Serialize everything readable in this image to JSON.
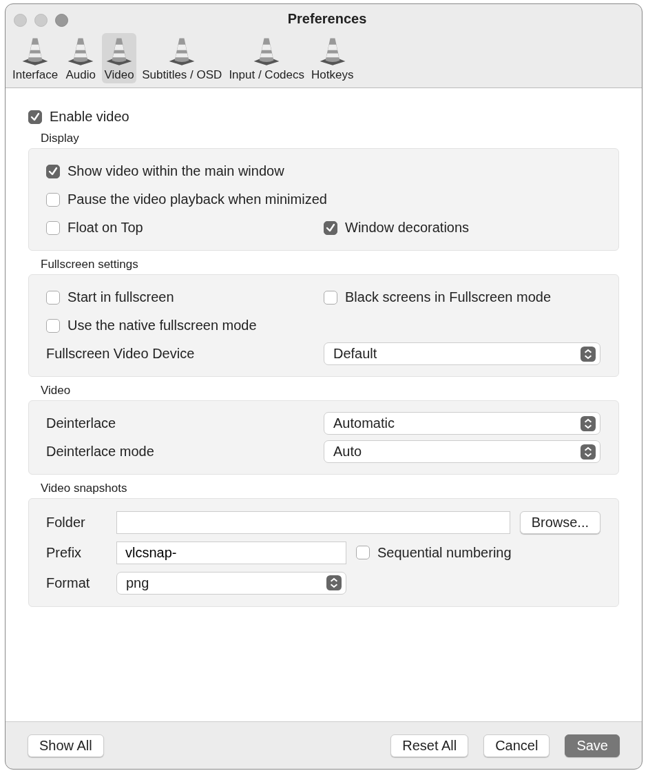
{
  "window": {
    "title": "Preferences"
  },
  "tabs": [
    {
      "label": "Interface",
      "selected": false
    },
    {
      "label": "Audio",
      "selected": false
    },
    {
      "label": "Video",
      "selected": true
    },
    {
      "label": "Subtitles / OSD",
      "selected": false
    },
    {
      "label": "Input / Codecs",
      "selected": false
    },
    {
      "label": "Hotkeys",
      "selected": false
    }
  ],
  "enable_video": {
    "label": "Enable video",
    "checked": true
  },
  "sections": [
    {
      "title": "Display",
      "kind": "columns",
      "rows": [
        [
          {
            "kind": "checkbox",
            "label": "Show video within the main window",
            "checked": true
          }
        ],
        [
          {
            "kind": "checkbox",
            "label": "Pause the video playback when minimized",
            "checked": false
          }
        ],
        [
          {
            "kind": "checkbox",
            "label": "Float on Top",
            "checked": false
          },
          {
            "kind": "checkbox",
            "label": "Window decorations",
            "checked": true
          }
        ]
      ]
    },
    {
      "title": "Fullscreen settings",
      "kind": "columns",
      "rows": [
        [
          {
            "kind": "checkbox",
            "label": "Start in fullscreen",
            "checked": false
          },
          {
            "kind": "checkbox",
            "label": "Black screens in Fullscreen mode",
            "checked": false
          }
        ],
        [
          {
            "kind": "checkbox",
            "label": "Use the native fullscreen mode",
            "checked": false
          }
        ],
        [
          {
            "kind": "label",
            "label": "Fullscreen Video Device"
          },
          {
            "kind": "select",
            "value": "Default"
          }
        ]
      ]
    },
    {
      "title": "Video",
      "kind": "columns",
      "rows": [
        [
          {
            "kind": "label",
            "label": "Deinterlace"
          },
          {
            "kind": "select",
            "value": "Automatic"
          }
        ],
        [
          {
            "kind": "label",
            "label": "Deinterlace mode"
          },
          {
            "kind": "select",
            "value": "Auto"
          }
        ]
      ]
    },
    {
      "title": "Video snapshots",
      "kind": "form",
      "rows": [
        [
          {
            "kind": "label",
            "label": "Folder"
          },
          {
            "kind": "text"
          },
          {
            "kind": "button",
            "label": "Browse..."
          }
        ],
        [
          {
            "kind": "label",
            "label": "Prefix"
          },
          {
            "kind": "text",
            "value": "vlcsnap-"
          },
          {
            "kind": "checkbox",
            "label": "Sequential numbering",
            "checked": false
          }
        ],
        [
          {
            "kind": "label",
            "label": "Format"
          },
          {
            "kind": "select",
            "value": "png"
          }
        ]
      ]
    }
  ],
  "footer": {
    "left": [
      {
        "label": "Show All",
        "default": false
      }
    ],
    "right": [
      {
        "label": "Reset All",
        "default": false
      },
      {
        "label": "Cancel",
        "default": false
      },
      {
        "label": "Save",
        "default": true
      }
    ]
  }
}
